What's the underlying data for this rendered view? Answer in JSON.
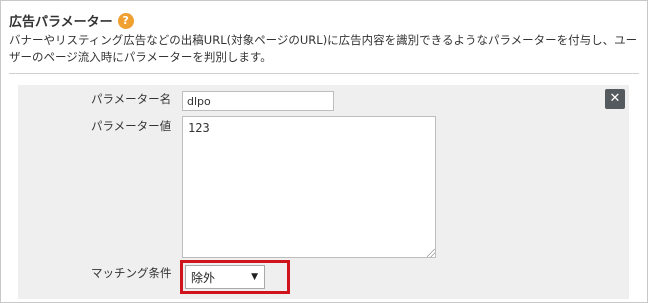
{
  "section": {
    "title": "広告パラメーター",
    "help_icon": "question-circle-icon",
    "help_glyph": "?",
    "description": "バナーやリスティング広告などの出稿URL(対象ページのURL)に広告内容を識別できるようなパラメーターを付与し、ユーザーのページ流入時にパラメーターを判別します。"
  },
  "form": {
    "name_label": "パラメーター名",
    "name_value": "dlpo",
    "value_label": "パラメーター値",
    "value_value": "123",
    "match_label": "マッチング条件",
    "match_selected": "除外",
    "close_glyph": "✕"
  },
  "colors": {
    "help_icon": "#f0a030",
    "highlight": "#d0141c",
    "close_button": "#555a5e",
    "panel_bg": "#efefef"
  }
}
